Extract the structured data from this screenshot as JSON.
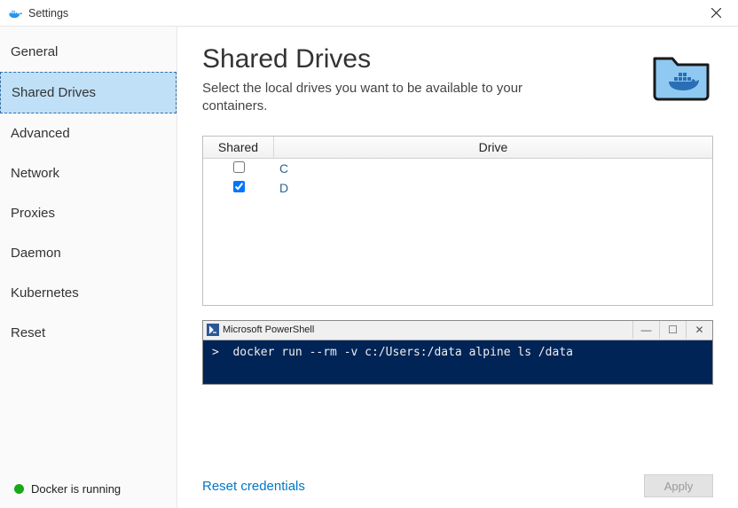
{
  "window": {
    "title": "Settings"
  },
  "sidebar": {
    "items": [
      {
        "label": "General"
      },
      {
        "label": "Shared Drives"
      },
      {
        "label": "Advanced"
      },
      {
        "label": "Network"
      },
      {
        "label": "Proxies"
      },
      {
        "label": "Daemon"
      },
      {
        "label": "Kubernetes"
      },
      {
        "label": "Reset"
      }
    ],
    "selected_index": 1
  },
  "status": {
    "text": "Docker is running",
    "color": "#18a818"
  },
  "page": {
    "title": "Shared Drives",
    "description": "Select the local drives you want to be available to your containers."
  },
  "table": {
    "headers": {
      "shared": "Shared",
      "drive": "Drive"
    },
    "rows": [
      {
        "shared": false,
        "drive": "C"
      },
      {
        "shared": true,
        "drive": "D"
      }
    ]
  },
  "powershell": {
    "title": "Microsoft PowerShell",
    "command": ">  docker run --rm -v c:/Users:/data alpine ls /data"
  },
  "footer": {
    "reset_link": "Reset credentials",
    "apply_label": "Apply"
  }
}
